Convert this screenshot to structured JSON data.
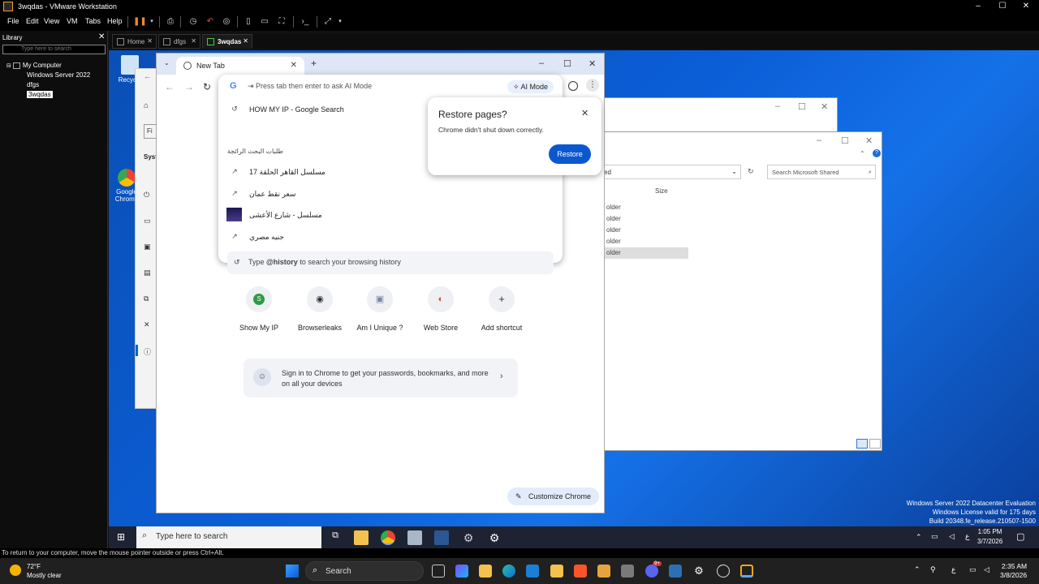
{
  "vm_window": {
    "title": "3wqdas - VMware Workstation",
    "menu": [
      "File",
      "Edit",
      "View",
      "VM",
      "Tabs",
      "Help"
    ],
    "library_title": "Library",
    "library_search_placeholder": "Type here to search",
    "tree": [
      "My Computer",
      "Windows Server 2022",
      "dfgs",
      "3wqdas"
    ],
    "tabs": [
      "Home",
      "dfgs",
      "3wqdas"
    ],
    "status_text": "To return to your computer, move the mouse pointer outside or press Ctrl+Alt."
  },
  "desktop": {
    "icons": [
      "Recycle",
      "Google Chrome"
    ],
    "settings_fragments": [
      "Fi",
      "Syst"
    ]
  },
  "explorer": {
    "search_placeholder": "Search Microsoft Shared",
    "column_size": "Size",
    "breadcrumb_fragment": "ed",
    "rows": [
      "older",
      "older",
      "older",
      "older",
      "older"
    ]
  },
  "chrome": {
    "tab_title": "New Tab",
    "omnibox_placeholder": "Press tab then enter to ask AI Mode",
    "ai_mode_label": "AI Mode",
    "suggestions": [
      {
        "text": "HOW MY IP - Google Search",
        "icon": "history-icon"
      },
      {
        "text": "مسلسل القاهر الحلقة 17",
        "icon": "trending-icon"
      },
      {
        "text": "سعر نقط عمان",
        "icon": "trending-icon"
      },
      {
        "text": "مسلسل - شارع الأعشى",
        "icon": "thumbnail"
      },
      {
        "text": "جنيه مصري",
        "icon": "trending-icon"
      }
    ],
    "trending_header": "طلبات البحث الرائجة",
    "history_tip_prefix": "Type ",
    "history_tip_keyword": "@history",
    "history_tip_suffix": " to search your browsing history",
    "shortcuts": [
      {
        "label": "Show My IP",
        "glyph": "S",
        "color": "#2e9a46"
      },
      {
        "label": "Browserleaks",
        "glyph": "◉",
        "color": "#555555"
      },
      {
        "label": "Am I Unique ?",
        "glyph": "▣",
        "color": "#7a86a8"
      },
      {
        "label": "Web Store",
        "glyph": "◐",
        "color": "#e0472b"
      },
      {
        "label": "Add shortcut",
        "glyph": "+",
        "color": "#333333"
      }
    ],
    "signin_text_line1": "Sign in to Chrome to get your passwords, bookmarks, and more",
    "signin_text_line2": "on all your devices",
    "customize_label": "Customize Chrome",
    "restore_popup": {
      "title": "Restore pages?",
      "message": "Chrome didn't shut down correctly.",
      "button": "Restore"
    }
  },
  "watermark": {
    "line1": "Windows Server 2022 Datacenter Evaluation",
    "line2": "Windows License valid for 175 days",
    "line3": "Build 20348.fe_release.210507-1500"
  },
  "guest_taskbar": {
    "search_placeholder": "Type here to search",
    "time": "1:05 PM",
    "date": "3/7/2026",
    "lang": "ع"
  },
  "host_taskbar": {
    "weather_temp": "72°F",
    "weather_desc": "Mostly clear",
    "search_label": "Search",
    "time": "2:35 AM",
    "date": "3/8/2026",
    "badge_count": "9+",
    "lang": "ع"
  }
}
